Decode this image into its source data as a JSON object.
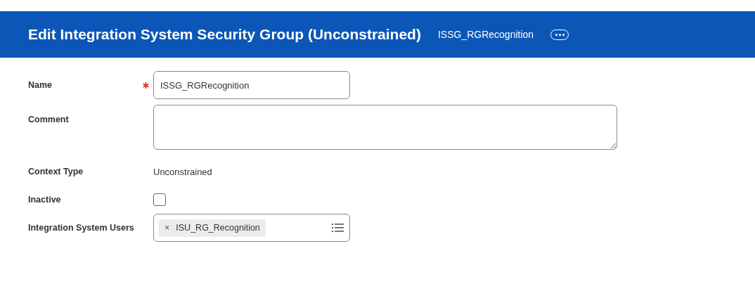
{
  "header": {
    "title": "Edit Integration System Security Group (Unconstrained)",
    "subtitle": "ISSG_RGRecognition"
  },
  "fields": [
    {
      "label": "Name",
      "kind": "text",
      "required": true,
      "value": "ISSG_RGRecognition"
    },
    {
      "label": "Comment",
      "kind": "textarea",
      "required": false
    },
    {
      "label": "Context Type",
      "kind": "static",
      "required": false,
      "value": "Unconstrained"
    },
    {
      "label": "Inactive",
      "kind": "checkbox",
      "required": false,
      "checked": false
    },
    {
      "label": "Integration System Users",
      "kind": "multiselect",
      "required": false,
      "tokens": [
        {
          "remove": "×",
          "label": "ISU_RG_Recognition"
        }
      ]
    }
  ]
}
